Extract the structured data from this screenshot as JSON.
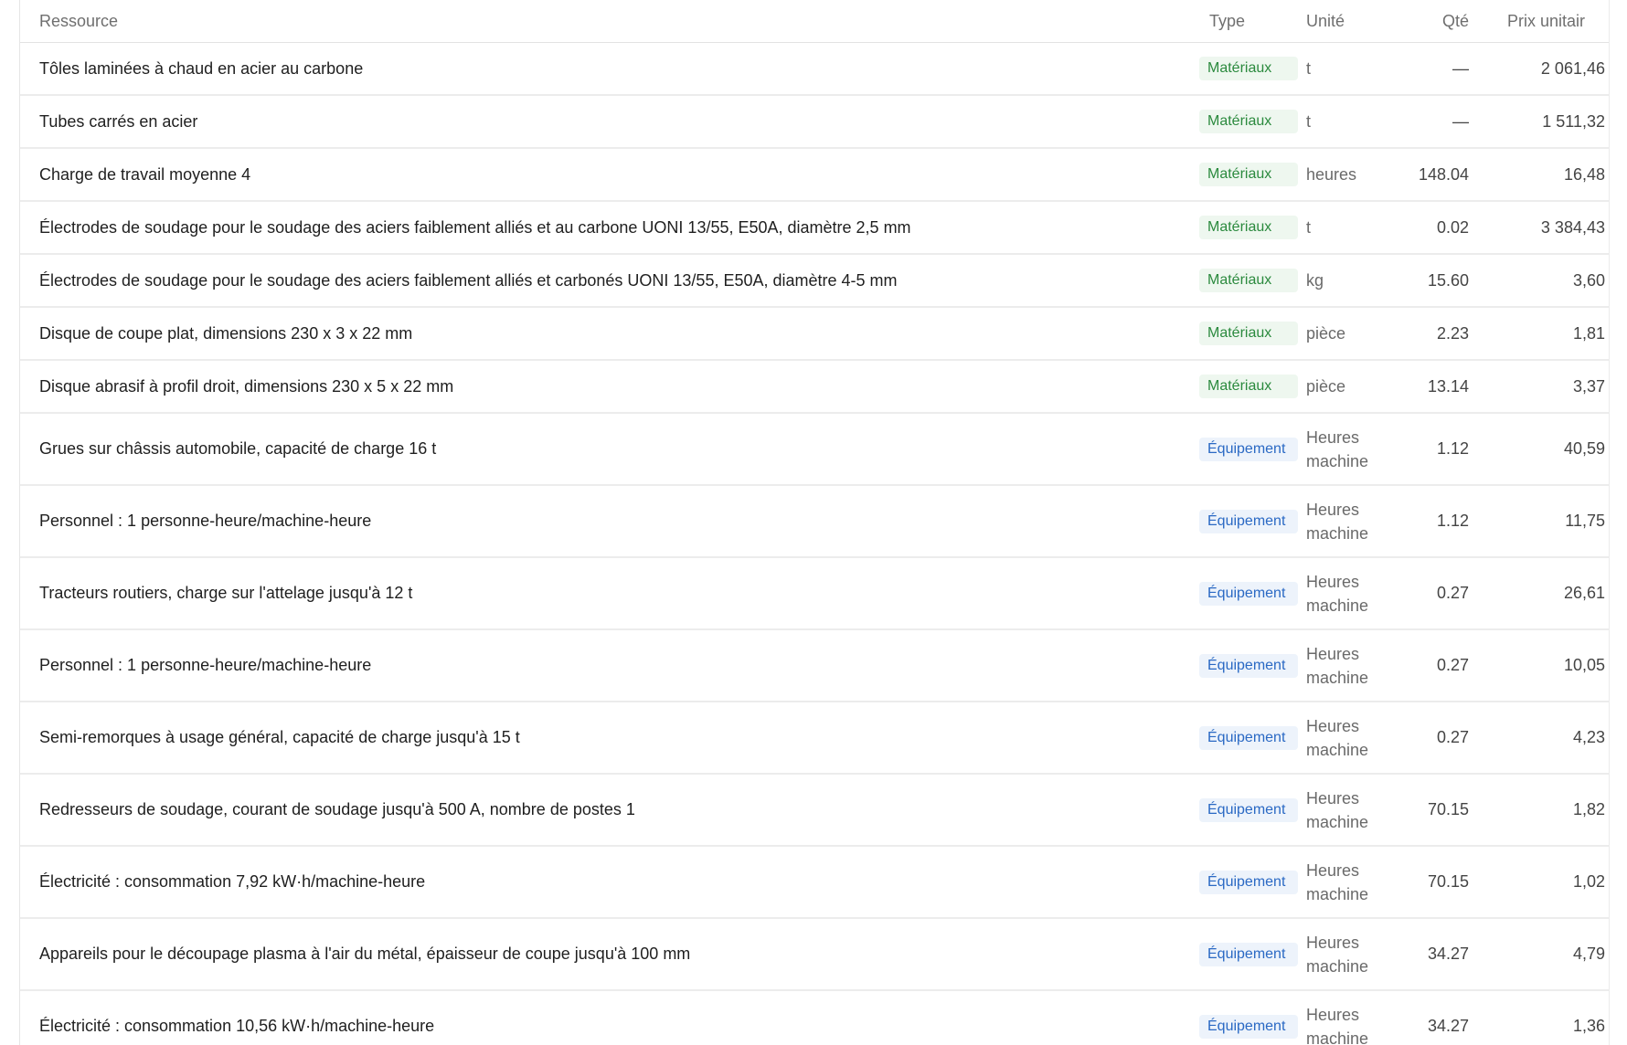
{
  "table": {
    "headers": {
      "resource": "Ressource",
      "type": "Type",
      "unit": "Unité",
      "qty": "Qté",
      "unit_price": "Prix unitair"
    },
    "rows": [
      {
        "name": "Tôles laminées à chaud en acier au carbone",
        "type": "Matériaux",
        "type_kind": "mat",
        "unit": "t",
        "qty": "—",
        "price": "2 061,46 "
      },
      {
        "name": "Tubes carrés en acier",
        "type": "Matériaux",
        "type_kind": "mat",
        "unit": "t",
        "qty": "—",
        "price": "1 511,32 "
      },
      {
        "name": "Charge de travail moyenne 4",
        "type": "Matériaux",
        "type_kind": "mat",
        "unit": "heures",
        "qty": "148.04",
        "price": "16,48 "
      },
      {
        "name": "Électrodes de soudage pour le soudage des aciers faiblement alliés et au carbone UONI 13/55, E50A, diamètre 2,5 mm",
        "type": "Matériaux",
        "type_kind": "mat",
        "unit": "t",
        "qty": "0.02",
        "price": "3 384,43 "
      },
      {
        "name": "Électrodes de soudage pour le soudage des aciers faiblement alliés et carbonés UONI 13/55, E50A, diamètre 4-5 mm",
        "type": "Matériaux",
        "type_kind": "mat",
        "unit": "kg",
        "qty": "15.60",
        "price": "3,60 "
      },
      {
        "name": "Disque de coupe plat, dimensions 230 x 3 x 22 mm",
        "type": "Matériaux",
        "type_kind": "mat",
        "unit": "pièce",
        "qty": "2.23",
        "price": "1,81 "
      },
      {
        "name": "Disque abrasif à profil droit, dimensions 230 x 5 x 22 mm",
        "type": "Matériaux",
        "type_kind": "mat",
        "unit": "pièce",
        "qty": "13.14",
        "price": "3,37 "
      },
      {
        "name": "Grues sur châssis automobile, capacité de charge 16 t",
        "type": "Équipement",
        "type_kind": "eq",
        "unit": "Heures machine",
        "qty": "1.12",
        "price": "40,59 "
      },
      {
        "name": "Personnel : 1 personne-heure/machine-heure",
        "type": "Équipement",
        "type_kind": "eq",
        "unit": "Heures machine",
        "qty": "1.12",
        "price": "11,75 "
      },
      {
        "name": "Tracteurs routiers, charge sur l'attelage jusqu'à 12 t",
        "type": "Équipement",
        "type_kind": "eq",
        "unit": "Heures machine",
        "qty": "0.27",
        "price": "26,61 "
      },
      {
        "name": "Personnel : 1 personne-heure/machine-heure",
        "type": "Équipement",
        "type_kind": "eq",
        "unit": "Heures machine",
        "qty": "0.27",
        "price": "10,05 "
      },
      {
        "name": "Semi-remorques à usage général, capacité de charge jusqu'à 15 t",
        "type": "Équipement",
        "type_kind": "eq",
        "unit": "Heures machine",
        "qty": "0.27",
        "price": "4,23 "
      },
      {
        "name": "Redresseurs de soudage, courant de soudage jusqu'à 500 A, nombre de postes 1",
        "type": "Équipement",
        "type_kind": "eq",
        "unit": "Heures machine",
        "qty": "70.15",
        "price": "1,82 "
      },
      {
        "name": "Électricité : consommation 7,92 kW·h/machine-heure",
        "type": "Équipement",
        "type_kind": "eq",
        "unit": "Heures machine",
        "qty": "70.15",
        "price": "1,02 "
      },
      {
        "name": "Appareils pour le découpage plasma à l'air du métal, épaisseur de coupe jusqu'à 100 mm",
        "type": "Équipement",
        "type_kind": "eq",
        "unit": "Heures machine",
        "qty": "34.27",
        "price": "4,79 "
      },
      {
        "name": "Électricité : consommation 10,56 kW·h/machine-heure",
        "type": "Équipement",
        "type_kind": "eq",
        "unit": "Heures machine",
        "qty": "34.27",
        "price": "1,36 "
      }
    ]
  }
}
